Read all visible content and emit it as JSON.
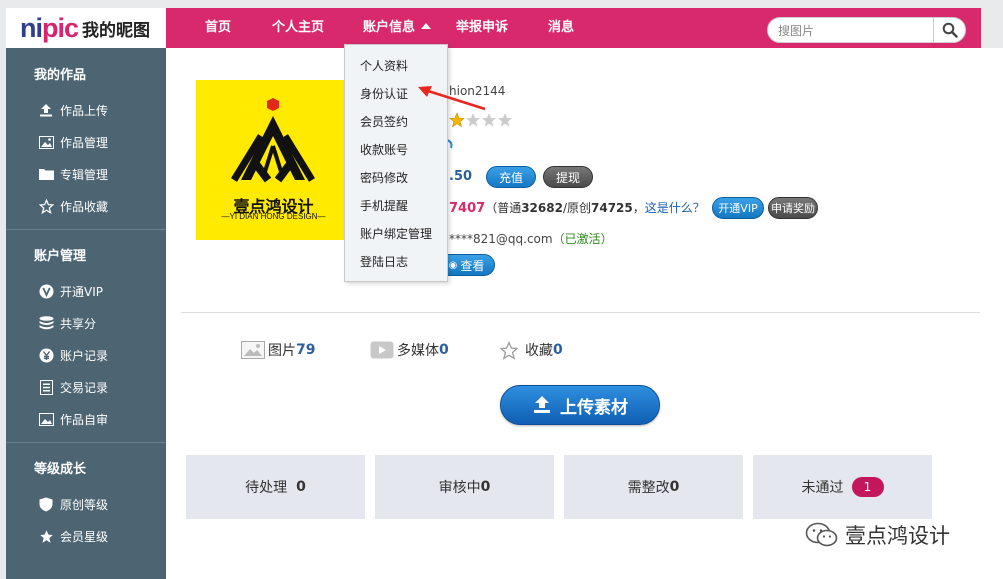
{
  "logo": {
    "nipic_a": "ni",
    "nipic_b": "pic",
    "title": "我的昵图"
  },
  "nav": [
    {
      "label": "首页"
    },
    {
      "label": "个人主页"
    },
    {
      "label": "账户信息"
    },
    {
      "label": "举报申诉"
    },
    {
      "label": "消息"
    }
  ],
  "search": {
    "placeholder": "搜图片"
  },
  "sidebar": {
    "groups": [
      {
        "title": "我的作品",
        "items": [
          "作品上传",
          "作品管理",
          "专辑管理",
          "作品收藏"
        ]
      },
      {
        "title": "账户管理",
        "items": [
          "开通VIP",
          "共享分",
          "账户记录",
          "交易记录",
          "作品自审"
        ]
      },
      {
        "title": "等级成长",
        "items": [
          "原创等级",
          "会员星级"
        ]
      }
    ]
  },
  "profile": {
    "username_partial": "hion2144",
    "balance_partial": ".50",
    "recharge_label": "充值",
    "withdraw_label": "提现",
    "share_points_partial": "7407",
    "share_detail_prefix": "（普通",
    "share_normal": "32682",
    "share_detail_mid": "/原创",
    "share_original": "74725",
    "share_detail_suffix": "，",
    "what_is_this": "这是什么？",
    "open_vip_label": "开通VIP",
    "apply_reward_label": "申请奖励",
    "email_partial": "****821@qq.com",
    "email_status": "（已激活）",
    "view_label": "查看",
    "avatar_brand_cn": "壹点鸿设计",
    "avatar_brand_en": "—YI DIAN HONG DESIGN—"
  },
  "stats": [
    {
      "label": "图片",
      "value": "79"
    },
    {
      "label": "多媒体",
      "value": "0"
    },
    {
      "label": "收藏",
      "value": "0"
    }
  ],
  "upload_label": "上传素材",
  "status_boxes": [
    {
      "label": "待处理",
      "value": "0"
    },
    {
      "label": "审核中",
      "value": "0"
    },
    {
      "label": "需整改",
      "value": "0"
    },
    {
      "label": "未通过",
      "value": "1"
    }
  ],
  "dropdown": {
    "items": [
      "个人资料",
      "身份认证",
      "会员签约",
      "收款账号",
      "密码修改",
      "手机提醒",
      "账户绑定管理",
      "登陆日志"
    ]
  },
  "watermark": "壹点鸿设计",
  "colors": {
    "nav_bg": "#d8296d",
    "sidebar_bg": "#4d6472",
    "accent_blue": "#1478c2",
    "badge": "#c2185b"
  }
}
